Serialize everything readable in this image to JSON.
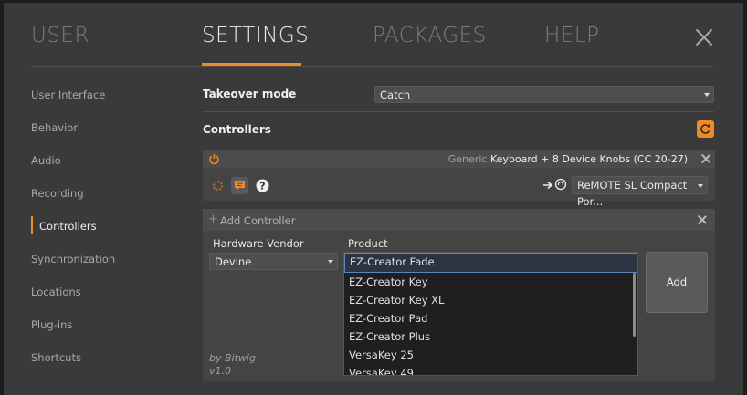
{
  "tabs": [
    "USER",
    "SETTINGS",
    "PACKAGES",
    "HELP"
  ],
  "sidebar": {
    "items": [
      "User Interface",
      "Behavior",
      "Audio",
      "Recording",
      "Controllers",
      "Synchronization",
      "Locations",
      "Plug-ins",
      "Shortcuts"
    ],
    "active": "Controllers"
  },
  "takeover": {
    "label": "Takeover mode",
    "value": "Catch"
  },
  "controllers": {
    "label": "Controllers"
  },
  "device": {
    "vendor_prefix": "Generic",
    "name": "Keyboard + 8 Device Knobs (CC 20-27)",
    "port": "ReMOTE SL Compact Por..."
  },
  "add_controller": {
    "title": "Add Controller",
    "vendor_header": "Hardware Vendor",
    "product_header": "Product",
    "vendor_value": "Devine",
    "products": [
      "EZ-Creator Fade",
      "EZ-Creator Key",
      "EZ-Creator Key XL",
      "EZ-Creator Pad",
      "EZ-Creator Plus",
      "VersaKey 25",
      "VersaKey 49"
    ],
    "selected_product": "EZ-Creator Fade",
    "add_label": "Add",
    "author": "by Bitwig",
    "version": "v1.0"
  },
  "colors": {
    "accent": "#f08a24",
    "selection": "#5b86b8"
  }
}
